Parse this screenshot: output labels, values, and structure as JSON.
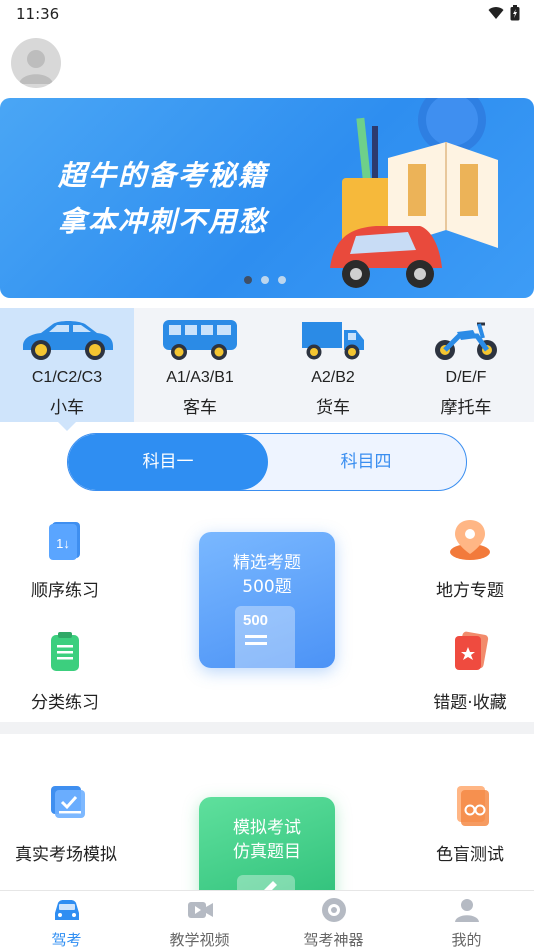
{
  "status_bar": {
    "time": "11:36"
  },
  "banner": {
    "line1": "超牛的备考秘籍",
    "line2": "拿本冲刺不用愁",
    "dots": 3,
    "active_dot": 0
  },
  "vehicles": [
    {
      "code": "C1/C2/C3",
      "name": "小车",
      "icon": "car-icon",
      "selected": true
    },
    {
      "code": "A1/A3/B1",
      "name": "客车",
      "icon": "bus-icon",
      "selected": false
    },
    {
      "code": "A2/B2",
      "name": "货车",
      "icon": "truck-icon",
      "selected": false
    },
    {
      "code": "D/E/F",
      "name": "摩托车",
      "icon": "motorcycle-icon",
      "selected": false
    }
  ],
  "subject_toggle": {
    "options": [
      "科目一",
      "科目四"
    ],
    "selected": "科目一"
  },
  "features": {
    "sequential": "顺序练习",
    "category": "分类练习",
    "featured_line1": "精选考题",
    "featured_line2": "500题",
    "featured_badge": "500",
    "local": "地方专题",
    "mistakes": "错题·收藏",
    "mock_real": "真实考场模拟",
    "mock_line1": "模拟考试",
    "mock_line2": "仿真题目",
    "color_blind": "色盲测试"
  },
  "bottom_nav": [
    {
      "label": "驾考",
      "icon": "car-nav-icon",
      "active": true
    },
    {
      "label": "教学视频",
      "icon": "video-icon",
      "active": false
    },
    {
      "label": "驾考神器",
      "icon": "tool-icon",
      "active": false
    },
    {
      "label": "我的",
      "icon": "user-icon",
      "active": false
    }
  ],
  "colors": {
    "accent": "#2f8ef2",
    "banner": "#3a97f3",
    "selected_tab": "#cfe4fb",
    "green_card": "#3cc985"
  }
}
